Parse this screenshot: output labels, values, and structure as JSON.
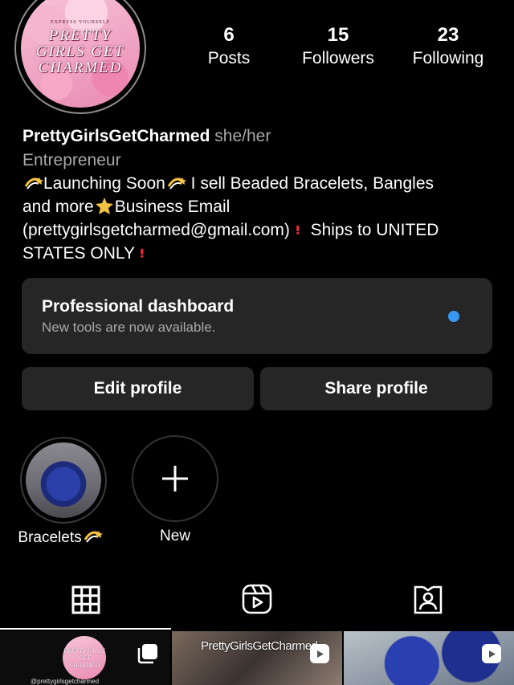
{
  "profile": {
    "avatar_tagline": "EXPRESS YOURSELF",
    "avatar_brand": "PRETTY GIRLS GET CHARMED",
    "name": "PrettyGirlsGetCharmed",
    "pronouns": "she/her",
    "category": "Entrepreneur",
    "bio_line1": "Launching Soon",
    "bio_line1b": " I sell Beaded Bracelets, Bangles",
    "bio_line2a": "and more",
    "bio_line2b": "Business Email",
    "bio_line3": "(prettygirlsgetcharmed@gmail.com) ",
    "bio_line3b": " Ships to UNITED",
    "bio_line4": "STATES ONLY "
  },
  "stats": [
    {
      "value": "6",
      "label": "Posts"
    },
    {
      "value": "15",
      "label": "Followers"
    },
    {
      "value": "23",
      "label": "Following"
    }
  ],
  "dashboard": {
    "title": "Professional dashboard",
    "subtitle": "New tools are now available.",
    "indicator_color": "#3897f0"
  },
  "buttons": {
    "edit": "Edit profile",
    "share": "Share profile"
  },
  "highlights": [
    {
      "label": "Bracelets",
      "icon": "dizzy-emoji"
    },
    {
      "label": "New",
      "icon": "plus-icon"
    }
  ],
  "tabs": [
    "grid-icon",
    "reels-icon",
    "tagged-icon"
  ],
  "grid": {
    "post1_brand": "PRETTY GIRLS GET CHARMED",
    "post1_caption": "@prettygirlsgetcharmed",
    "post2_caption": "PrettyGirlsGetCharmed"
  }
}
